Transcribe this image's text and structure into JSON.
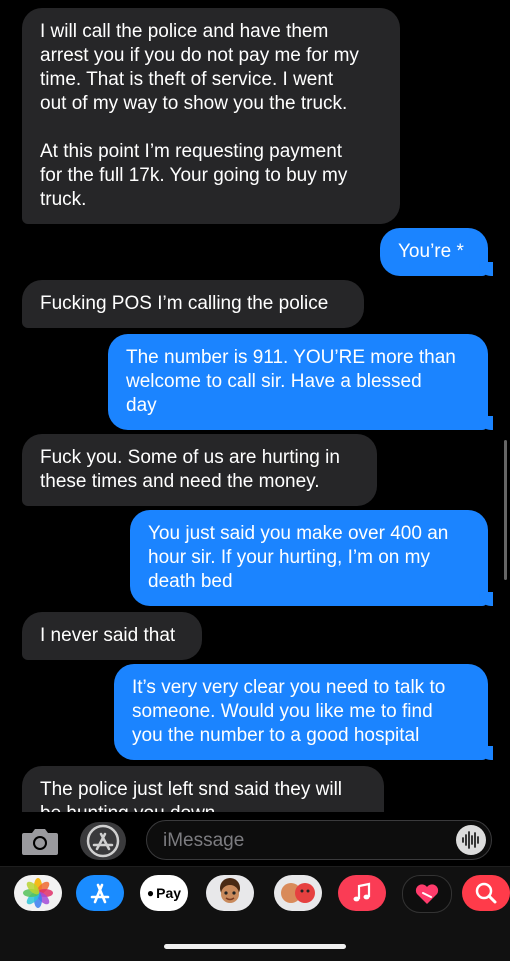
{
  "messages": [
    {
      "dir": "in",
      "text": "I will call the police and have them\narrest you if you do not pay me for my\ntime. That is theft of service. I went\nout of my way to show you the truck.\n\nAt this point I’m requesting payment\nfor the full 17k. Your going to buy my\ntruck."
    },
    {
      "dir": "out",
      "text": "You’re *"
    },
    {
      "dir": "in",
      "text": "Fucking POS I’m calling the police"
    },
    {
      "dir": "out",
      "text": "The number is 911. YOU’RE more than\nwelcome to call sir. Have a blessed\nday"
    },
    {
      "dir": "in",
      "text": "Fuck you. Some of us are hurting in\nthese times and need the money."
    },
    {
      "dir": "out",
      "text": "You just said you make over 400 an\nhour sir. If your hurting, I’m on my\ndeath bed"
    },
    {
      "dir": "in",
      "text": "I never said that"
    },
    {
      "dir": "out",
      "text": "It’s very very clear you need to talk to\nsomeone. Would you like me to find\nyou the number to a good hospital"
    },
    {
      "dir": "in",
      "text": "The police just left snd said they will\nbe hunting you down"
    }
  ],
  "compose": {
    "placeholder": "iMessage"
  },
  "apps": [
    {
      "name": "photos-app-icon"
    },
    {
      "name": "app-store-app-icon"
    },
    {
      "name": "apple-pay-app-icon",
      "label": "Pay"
    },
    {
      "name": "memoji-app-icon"
    },
    {
      "name": "memoji-stickers-app-icon"
    },
    {
      "name": "music-app-icon"
    },
    {
      "name": "digital-touch-app-icon"
    },
    {
      "name": "images-search-app-icon"
    }
  ],
  "colors": {
    "incoming": "#262628",
    "outgoing": "#1b84ff",
    "background": "#000000"
  }
}
